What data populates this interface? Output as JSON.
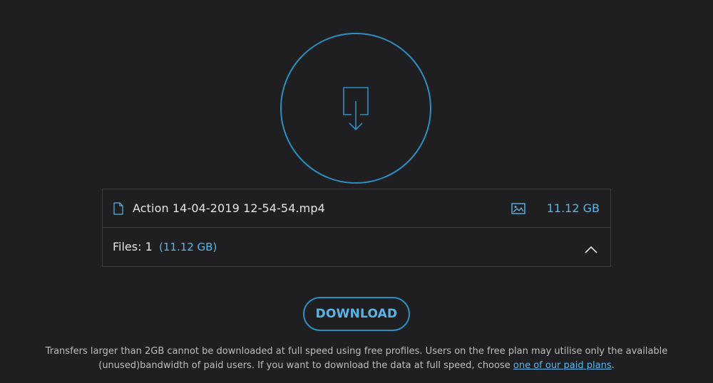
{
  "icons": {
    "download": "download-icon",
    "file": "file-icon",
    "preview": "image-icon",
    "collapse": "chevron-up-icon"
  },
  "colors": {
    "background": "#1f1f21",
    "accent": "#2d8fbf",
    "accent_text": "#5ab4e6",
    "border": "#3d3d40"
  },
  "file": {
    "name": "Action 14-04-2019 12-54-54.mp4",
    "size": "11.12 GB"
  },
  "summary": {
    "files_label": "Files:  1",
    "total_size": "(11.12 GB)"
  },
  "download_button": {
    "label": "DOWNLOAD"
  },
  "notice": {
    "line1": "Transfers larger than 2GB cannot be downloaded at full speed using free profiles. Users on the free plan may utilise only the available",
    "line2_prefix": "(unused)bandwidth of paid users. If you want to download the data at full speed, choose ",
    "link_text": "one of our paid plans",
    "line2_suffix": "."
  }
}
